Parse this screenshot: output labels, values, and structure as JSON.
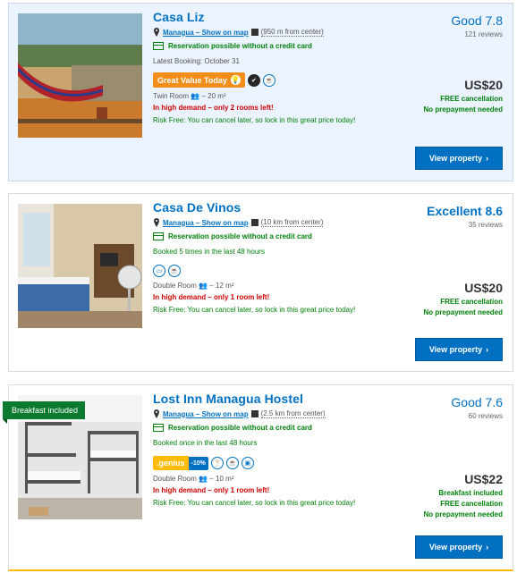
{
  "listings": [
    {
      "name": "Casa Liz",
      "location": "Managua",
      "map_link": "Show on map",
      "distance": "(950 m from center)",
      "reservation": "Reservation possible without a credit card",
      "booking_note": "Latest Booking: October 31",
      "badge": "Great Value Today",
      "room": "Twin Room",
      "room_size": "– 20 m²",
      "demand": "In high demand – only 2 rooms left!",
      "risk_free": "Risk Free: You can cancel later, so lock in this great price today!",
      "score_label": "Good 7.8",
      "reviews": "121 reviews",
      "price": "US$20",
      "price_notes": [
        "FREE cancellation",
        "No prepayment needed"
      ],
      "cta": "View property"
    },
    {
      "name": "Casa De Vinos",
      "location": "Managua",
      "map_link": "Show on map",
      "distance": "(10 km from center)",
      "reservation": "Reservation possible without a credit card",
      "booking_note": "Booked 5 times in the last 48 hours",
      "room": "Double Room",
      "room_size": "– 12 m²",
      "demand": "In high demand – only 1 room left!",
      "risk_free": "Risk Free: You can cancel later, so lock in this great price today!",
      "score_label": "Excellent 8.6",
      "reviews": "35 reviews",
      "price": "US$20",
      "price_notes": [
        "FREE cancellation",
        "No prepayment needed"
      ],
      "cta": "View property"
    },
    {
      "name": "Lost Inn Managua Hostel",
      "ribbon": "Breakfast included",
      "location": "Managua",
      "map_link": "Show on map",
      "distance": "(2.5 km from center)",
      "reservation": "Reservation possible without a credit card",
      "booking_note": "Booked once in the last 48 hours",
      "genius": ".genius",
      "genius_discount": "-10%",
      "room": "Double Room",
      "room_size": "– 10 m²",
      "demand": "In high demand – only 1 room left!",
      "risk_free": "Risk Free: You can cancel later, so lock in this great price today!",
      "score_label": "Good 7.6",
      "reviews": "60 reviews",
      "price": "US$22",
      "price_notes": [
        "Breakfast included",
        "FREE cancellation",
        "No prepayment needed"
      ],
      "cta": "View property"
    }
  ],
  "icons": [
    "pin-icon",
    "map-icon",
    "credit-card-icon",
    "lightbulb-icon",
    "checkmark-icon",
    "breakfast-icon",
    "bed-icon",
    "parking-icon",
    "cocktail-icon",
    "coffee-icon",
    "people-icon",
    "chevron-right-icon"
  ],
  "colors": {
    "link": "#0071c2",
    "green": "#008009",
    "demand": "#cc0000",
    "great_value": "#f48e1a",
    "genius": "#febb02",
    "ribbon": "#0a7a2f"
  }
}
